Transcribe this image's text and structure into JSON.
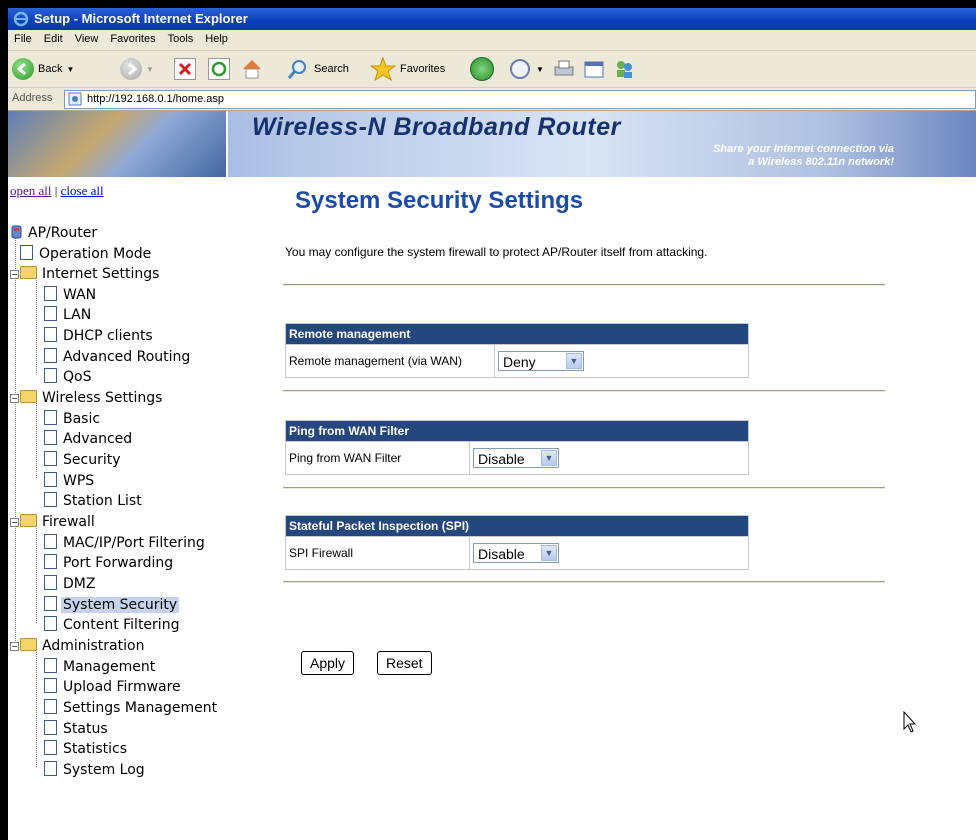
{
  "window": {
    "title": "Setup - Microsoft Internet Explorer"
  },
  "menubar": {
    "items": [
      "File",
      "Edit",
      "View",
      "Favorites",
      "Tools",
      "Help"
    ]
  },
  "toolbar": {
    "back_label": "Back",
    "search_label": "Search",
    "favorites_label": "Favorites"
  },
  "addressbar": {
    "label": "Address",
    "url": "http://192.168.0.1/home.asp"
  },
  "banner": {
    "title": "Wireless-N Broadband Router",
    "subtitle_line1": "Share your Internet connection via",
    "subtitle_line2": "a Wireless 802.11n network!"
  },
  "sidebar": {
    "open_all": "open all",
    "separator": "|",
    "close_all": "close all",
    "tree": [
      {
        "label": "AP/Router"
      },
      {
        "label": "Operation Mode"
      },
      {
        "label": "Internet Settings"
      },
      {
        "label": "WAN"
      },
      {
        "label": "LAN"
      },
      {
        "label": "DHCP clients"
      },
      {
        "label": "Advanced Routing"
      },
      {
        "label": "QoS"
      },
      {
        "label": "Wireless Settings"
      },
      {
        "label": "Basic"
      },
      {
        "label": "Advanced"
      },
      {
        "label": "Security"
      },
      {
        "label": "WPS"
      },
      {
        "label": "Station List"
      },
      {
        "label": "Firewall"
      },
      {
        "label": "MAC/IP/Port Filtering"
      },
      {
        "label": "Port Forwarding"
      },
      {
        "label": "DMZ"
      },
      {
        "label": "System Security"
      },
      {
        "label": "Content Filtering"
      },
      {
        "label": "Administration"
      },
      {
        "label": "Management"
      },
      {
        "label": "Upload Firmware"
      },
      {
        "label": "Settings Management"
      },
      {
        "label": "Status"
      },
      {
        "label": "Statistics"
      },
      {
        "label": "System Log"
      }
    ],
    "selected": "System Security"
  },
  "main": {
    "title": "System Security Settings",
    "description": "You may configure the system firewall to protect AP/Router itself from attacking.",
    "sections": [
      {
        "header": "Remote management",
        "label": "Remote management (via WAN)",
        "value": "Deny"
      },
      {
        "header": "Ping from WAN Filter",
        "label": "Ping from WAN Filter",
        "value": "Disable"
      },
      {
        "header": "Stateful Packet Inspection (SPI)",
        "label": "SPI Firewall",
        "value": "Disable"
      }
    ],
    "apply_label": "Apply",
    "reset_label": "Reset"
  },
  "colors": {
    "title_blue": "#1d4ca8",
    "table_header": "#25477f",
    "selected_item": "#c6d3ec"
  }
}
